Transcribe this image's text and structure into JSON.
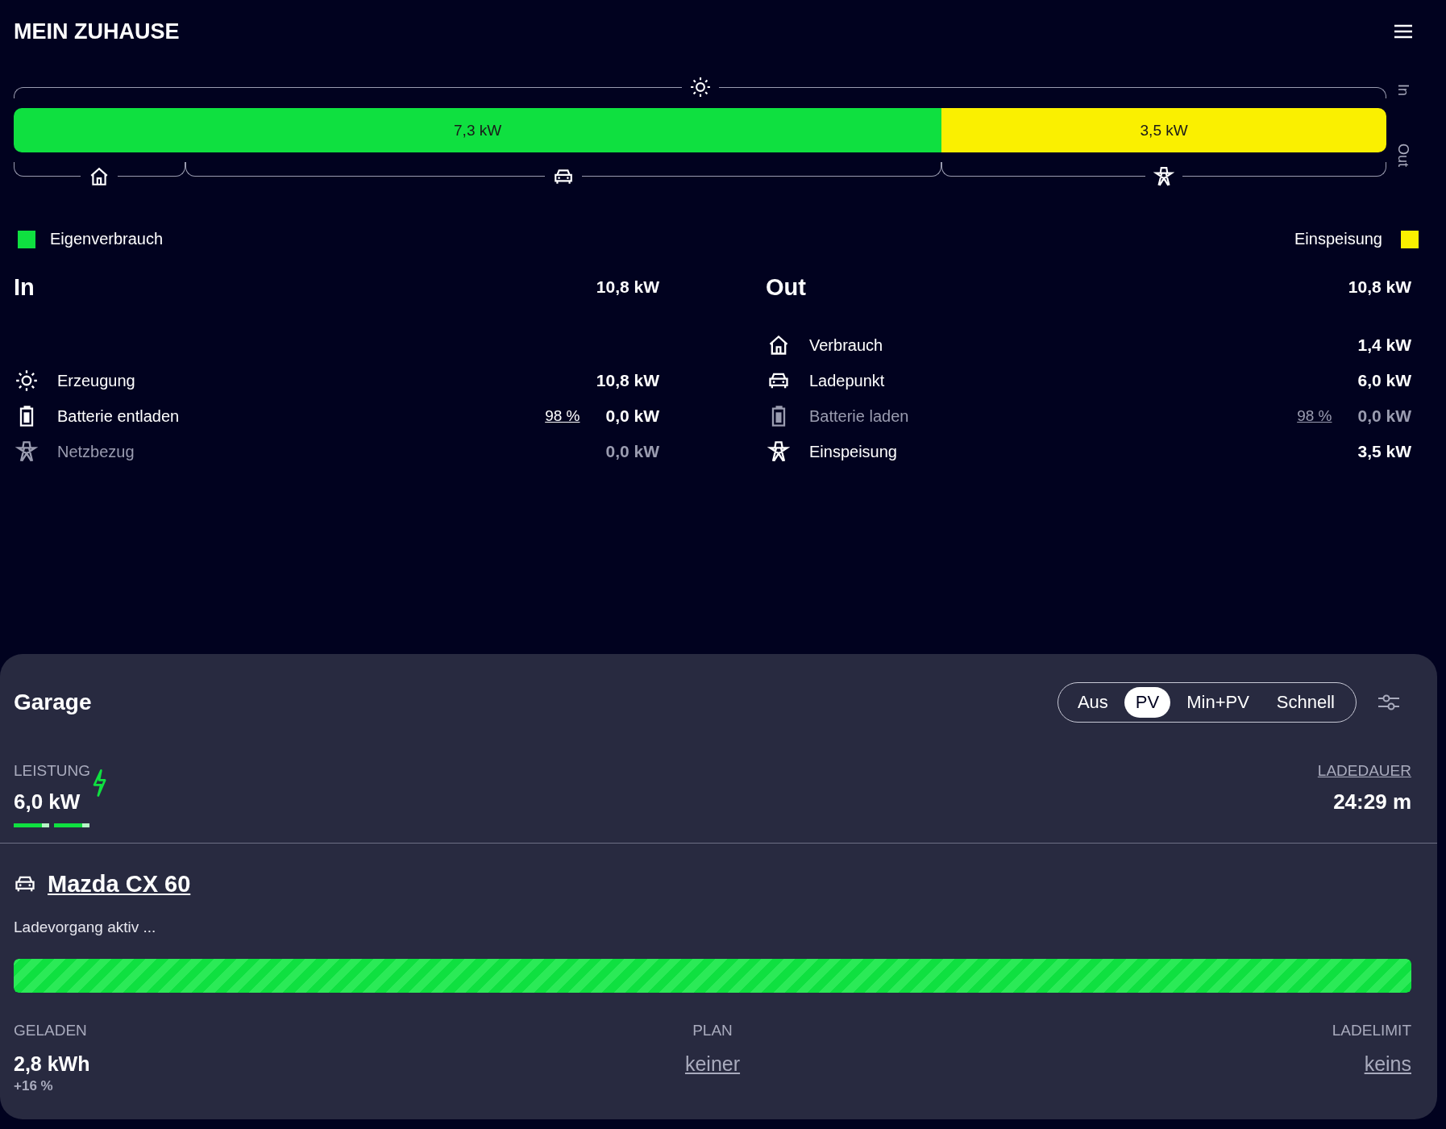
{
  "header": {
    "title": "MEIN ZUHAUSE"
  },
  "energy_flow": {
    "in_label": "In",
    "out_label": "Out",
    "segments": [
      {
        "label": "7,3 kW",
        "kind": "self"
      },
      {
        "label": "3,5 kW",
        "kind": "feed"
      }
    ],
    "consumers": [
      {
        "kind": "home"
      },
      {
        "kind": "vehicle"
      },
      {
        "kind": "grid"
      }
    ]
  },
  "legend": [
    {
      "label": "Eigenverbrauch",
      "color": "#0fe040"
    },
    {
      "label": "Einspeisung",
      "color": "#faf000"
    }
  ],
  "in": {
    "title": "In",
    "total": "10,8 kW",
    "rows": [
      {
        "kind": "solar",
        "label": "Erzeugung",
        "value": "10,8 kW",
        "active": true
      },
      {
        "kind": "battery",
        "label": "Batterie entladen",
        "percent": "98 %",
        "value": "0,0 kW",
        "active": true
      },
      {
        "kind": "grid",
        "label": "Netzbezug",
        "value": "0,0 kW",
        "active": false
      }
    ]
  },
  "out": {
    "title": "Out",
    "total": "10,8 kW",
    "rows": [
      {
        "kind": "home",
        "label": "Verbrauch",
        "value": "1,4 kW",
        "active": true
      },
      {
        "kind": "vehicle",
        "label": "Ladepunkt",
        "value": "6,0 kW",
        "active": true
      },
      {
        "kind": "battery",
        "label": "Batterie laden",
        "percent": "98 %",
        "value": "0,0 kW",
        "active": false
      },
      {
        "kind": "grid",
        "label": "Einspeisung",
        "value": "3,5 kW",
        "active": true
      }
    ]
  },
  "loadpoint": {
    "title": "Garage",
    "modes": [
      {
        "label": "Aus",
        "selected": false
      },
      {
        "label": "PV",
        "selected": true
      },
      {
        "label": "Min+PV",
        "selected": false
      },
      {
        "label": "Schnell",
        "selected": false
      }
    ],
    "power": {
      "label": "LEISTUNG",
      "value": "6,0 kW",
      "phases": [
        {
          "level": 0.8
        },
        {
          "level": 0.8
        }
      ]
    },
    "duration": {
      "label": "LADEDAUER",
      "value": "24:29 m"
    },
    "vehicle": {
      "name": "Mazda CX 60",
      "status": "Ladevorgang aktiv ...",
      "level": 1
    },
    "stats": [
      {
        "label": "GELADEN",
        "value": "2,8 kWh",
        "sub": "+16 %",
        "kind": "plain"
      },
      {
        "label": "PLAN",
        "value": "keiner",
        "kind": "link"
      },
      {
        "label": "LADELIMIT",
        "value": "keins",
        "kind": "link"
      }
    ]
  }
}
